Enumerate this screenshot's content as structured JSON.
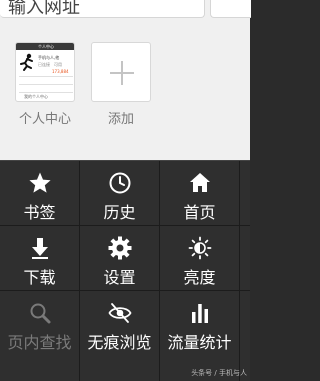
{
  "address_bar": {
    "placeholder": "输入网址"
  },
  "speed_dial": [
    {
      "label": "个人中心"
    },
    {
      "label": "添加"
    }
  ],
  "thumbnail": {
    "header": "个人中心",
    "line1": "手机与人,他",
    "line2": "已连接",
    "line3": "可用",
    "value": "173,884",
    "footer": "我的个人中心"
  },
  "menu": [
    {
      "label": "书签",
      "icon": "star-icon",
      "enabled": true
    },
    {
      "label": "历史",
      "icon": "clock-icon",
      "enabled": true
    },
    {
      "label": "首页",
      "icon": "home-icon",
      "enabled": true
    },
    {
      "label": "下载",
      "icon": "download-icon",
      "enabled": true
    },
    {
      "label": "设置",
      "icon": "gear-icon",
      "enabled": true
    },
    {
      "label": "亮度",
      "icon": "sun-icon",
      "enabled": true
    },
    {
      "label": "页内查找",
      "icon": "search-icon",
      "enabled": false
    },
    {
      "label": "无痕浏览",
      "icon": "eye-slash-icon",
      "enabled": true
    },
    {
      "label": "流量统计",
      "icon": "bar-chart-icon",
      "enabled": true
    }
  ],
  "watermark": "头条号 / 手机与人",
  "colors": {
    "thumb_accent": "#e8551e",
    "menu_bg": "#2f2f2f",
    "top_bg": "#f0f0f0"
  }
}
